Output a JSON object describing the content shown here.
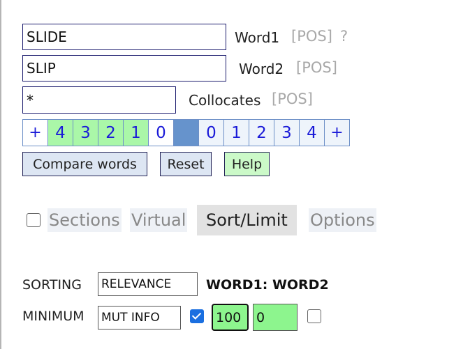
{
  "word1": {
    "value": "SLIDE",
    "label": "Word1",
    "pos": "[POS]",
    "help_mark": "?"
  },
  "word2": {
    "value": "SLIP",
    "label": "Word2",
    "pos": "[POS]"
  },
  "collocates": {
    "value": "*",
    "label": "Collocates",
    "pos": "[POS]"
  },
  "span": {
    "left": [
      "+",
      "4",
      "3",
      "2",
      "1",
      "0"
    ],
    "right": [
      "0",
      "1",
      "2",
      "3",
      "4",
      "+"
    ]
  },
  "buttons": {
    "compare": "Compare words",
    "reset": "Reset",
    "help": "Help"
  },
  "tabs": {
    "sections": "Sections",
    "virtual": "Virtual",
    "sort_limit": "Sort/Limit",
    "options": "Options",
    "active": "Sort/Limit"
  },
  "sorting": {
    "label": "SORTING",
    "value": "RELEVANCE",
    "order": "WORD1: WORD2"
  },
  "minimum": {
    "label": "MINIMUM",
    "value": "MUT INFO",
    "checked": true,
    "freq": "100",
    "mi": "0",
    "extra_checked": false
  },
  "colors": {
    "green": "#aaf7a8",
    "center": "#6693cc",
    "link": "#1a1ad8"
  }
}
